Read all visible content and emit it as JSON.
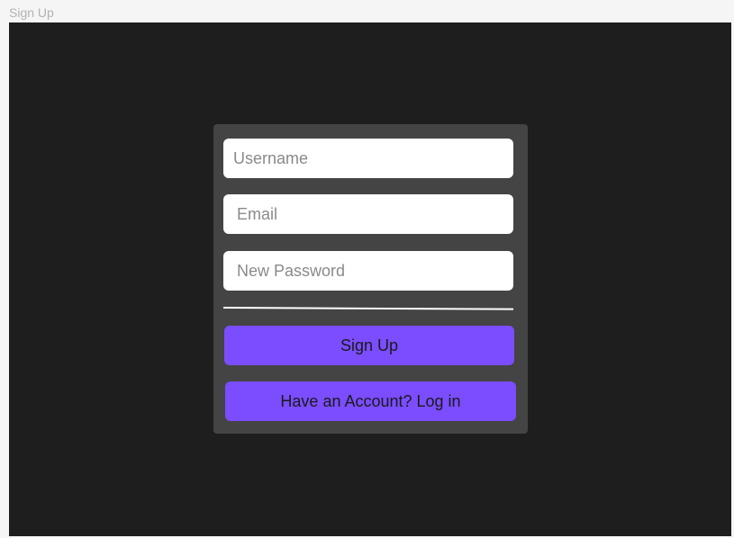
{
  "frame": {
    "title": "Sign Up"
  },
  "form": {
    "username_placeholder": "Username",
    "email_placeholder": "Email",
    "password_placeholder": "New Password",
    "signup_label": "Sign Up",
    "login_label": "Have an Account? Log in"
  },
  "colors": {
    "canvas_bg": "#1e1e1e",
    "card_bg": "#444444",
    "button_accent": "#7b4dff",
    "field_bg": "#ffffff"
  }
}
